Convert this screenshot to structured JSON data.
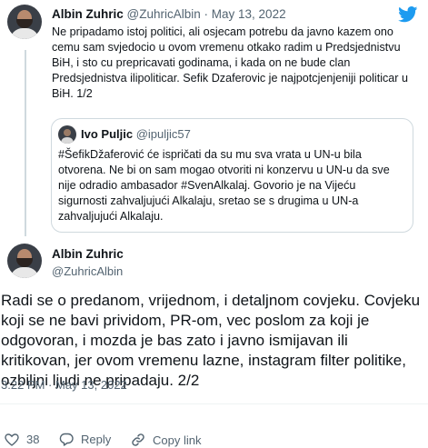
{
  "first_tweet": {
    "author_name": "Albin Zuhric",
    "handle": "@ZuhricAlbin",
    "separator": "·",
    "date": "May 13, 2022",
    "text": "Ne pripadamo istoj politici, ali osjecam potrebu da javno kazem ono cemu sam svjedocio u ovom vremenu otkako radim u Predsjednistvu BiH, i sto cu prepricavati godinama, i kada on ne bude clan Predsjednistva ilipoliticar. Sefik Dzaferovic je najpotcjenjeniji politicar u BiH. 1/2"
  },
  "quoted_tweet": {
    "author_name": "Ivo Puljic",
    "handle": "@ipuljic57",
    "text": "#ŠefikDžaferović će ispričati da su mu sva vrata u UN-u bila otvorena. Ne bi on sam mogao otvoriti ni konzervu u UN-u da sve nije odradio ambasador #SvenAlkalaj. Govorio je na Vijeću sigurnosti zahvaljujući Alkalaju, sretao se s drugima u UN-a zahvaljujući Alkalaju."
  },
  "main_tweet": {
    "author_name": "Albin Zuhric",
    "handle": "@ZuhricAlbin",
    "text": "Radi se o predanom, vrijednom, i detaljnom covjeku. Covjeku koji se ne bavi prividom, PR-om, vec poslom za koji je odgovoran, i mozda je bas zato i javno ismijavan ili kritikovan, jer ovom vremenu lazne, instagram filter politike, ozbiljni ljudi ne pripadaju. 2/2",
    "time": "3:22 PM",
    "separator": "·",
    "date": "May 13, 2022"
  },
  "actions": {
    "like_count": "38",
    "reply_label": "Reply",
    "copy_link_label": "Copy link"
  },
  "icons": {
    "brand": "twitter-bird-icon",
    "like": "heart-icon",
    "reply": "speech-bubble-icon",
    "copy_link": "link-icon"
  },
  "colors": {
    "twitter_blue": "#1d9bf0",
    "text": "#0f1419",
    "muted": "#536471",
    "border": "#cfd9de"
  }
}
